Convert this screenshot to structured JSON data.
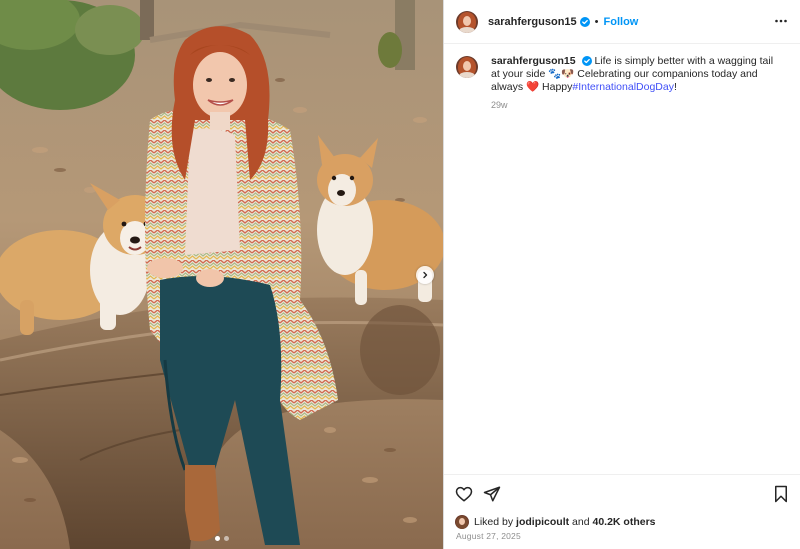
{
  "post": {
    "username": "sarahferguson15",
    "separator": "•",
    "follow_label": "Follow",
    "caption": {
      "username": "sarahferguson15",
      "text_part1": "Life is simply better with a wagging tail at your side",
      "emoji1": "🐾🐶",
      "text_part2": "Celebrating our companions today and always",
      "emoji2": "❤️",
      "text_part3": "Happy",
      "hashtag": "#InternationalDogDay",
      "text_end": "!",
      "time": "29w"
    },
    "likes": {
      "prefix": "Liked by",
      "user": "jodipicoult",
      "connector": "and",
      "others": "40.2K others"
    },
    "date": "August 27, 2025"
  },
  "colors": {
    "accent": "#0095f6",
    "hashtag": "#4150f7",
    "verified": "#0095f6",
    "muted": "#8e8e8e"
  },
  "icons": {
    "more": "more-options-icon",
    "like": "heart-icon",
    "share": "paper-plane-icon",
    "save": "bookmark-icon",
    "next": "chevron-right-icon",
    "verified": "verified-badge-icon"
  }
}
